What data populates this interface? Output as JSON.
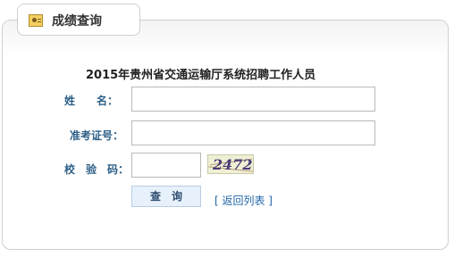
{
  "tab": {
    "title": "成绩查询",
    "icon": "user-card-icon"
  },
  "form": {
    "title": "2015年贵州省交通运输厅系统招聘工作人员",
    "name_label": "姓　　名：",
    "id_label": "准考证号：",
    "captcha_label": "校　验　码：",
    "name_value": "",
    "id_value": "",
    "captcha_value": "",
    "captcha_image_text": "2472",
    "query_button": "查　询",
    "back_link": "[ 返回列表 ]"
  },
  "colors": {
    "label": "#2d5f87",
    "link": "#2267a9",
    "button_bg": "#e7f1fb",
    "captcha_bg": "#efefd4"
  }
}
